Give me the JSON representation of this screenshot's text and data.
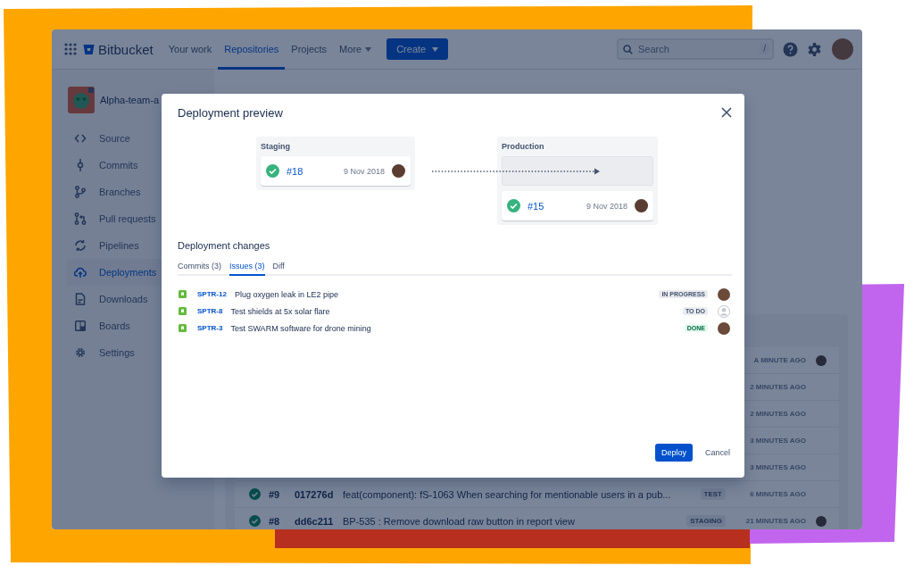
{
  "app": {
    "product": "Bitbucket",
    "nav": [
      {
        "label": "Your work",
        "selected": false,
        "dropdown": false
      },
      {
        "label": "Repositories",
        "selected": true,
        "dropdown": false
      },
      {
        "label": "Projects",
        "selected": false,
        "dropdown": false
      },
      {
        "label": "More",
        "selected": false,
        "dropdown": true
      }
    ],
    "create_button": "Create",
    "search": {
      "placeholder": "Search",
      "shortcut": "/"
    }
  },
  "sidebar": {
    "repository": "Alpha-team-a",
    "items": [
      {
        "label": "Source",
        "selected": false
      },
      {
        "label": "Commits",
        "selected": false
      },
      {
        "label": "Branches",
        "selected": false
      },
      {
        "label": "Pull requests",
        "selected": false
      },
      {
        "label": "Pipelines",
        "selected": false
      },
      {
        "label": "Deployments",
        "selected": true
      },
      {
        "label": "Downloads",
        "selected": false
      },
      {
        "label": "Boards",
        "selected": false
      },
      {
        "label": "Settings",
        "selected": false
      }
    ]
  },
  "deployments": {
    "rows": [
      {
        "time": "A MINUTE AGO",
        "avatar": true
      },
      {
        "time": "2 MINUTES AGO",
        "avatar": false
      },
      {
        "time": "2 MINUTES AGO",
        "avatar": false
      },
      {
        "time": "3 MINUTES AGO",
        "avatar": false
      },
      {
        "time": "3 MINUTES AGO",
        "avatar": false
      },
      {
        "number": "#9",
        "hash": "017276d",
        "message": "feat(component): fS-1063 When searching for mentionable users in a pub...",
        "environment": "TEST",
        "time": "6 MINUTES AGO",
        "avatar": false
      },
      {
        "number": "#8",
        "hash": "dd6c211",
        "message": "BP-535 : Remove download raw button in report view",
        "environment": "STAGING",
        "time": "21 MINUTES AGO",
        "avatar": true
      }
    ]
  },
  "modal": {
    "title": "Deployment preview",
    "environments": [
      {
        "name": "Staging",
        "empty_slot": false,
        "build": "#18",
        "date": "9 Nov 2018"
      },
      {
        "name": "Production",
        "empty_slot": true,
        "build": "#15",
        "date": "9 Nov 2018"
      }
    ],
    "changes_title": "Deployment changes",
    "tabs": [
      {
        "label": "Commits (3)",
        "selected": false
      },
      {
        "label": "Issues (3)",
        "selected": true
      },
      {
        "label": "Diff",
        "selected": false
      }
    ],
    "issues": [
      {
        "key": "SPTR-12",
        "summary": "Plug oxygen leak in LE2 pipe",
        "status": "IN PROGRESS",
        "kind": "inprogress",
        "assigned": true
      },
      {
        "key": "SPTR-8",
        "summary": "Test shields at 5x solar flare",
        "status": "TO DO",
        "kind": "todo",
        "assigned": false
      },
      {
        "key": "SPTR-3",
        "summary": "Test SWARM software for drone mining",
        "status": "DONE",
        "kind": "done",
        "assigned": true
      }
    ],
    "primary_button": "Deploy",
    "secondary_button": "Cancel"
  }
}
